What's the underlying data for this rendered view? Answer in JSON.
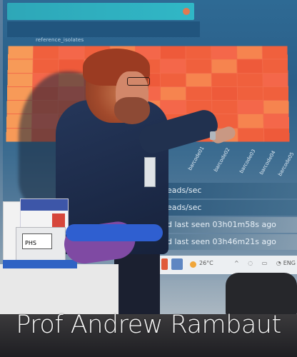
{
  "photo": {
    "screen_small_text": "reference_isolates",
    "heatmap_tick_labels": [
      "barcode01",
      "barcode02",
      "barcode03",
      "barcode04",
      "barcode05"
    ],
    "status_rows": [
      "eads/sec",
      "eads/sec",
      "d last seen 03h01m58s ago",
      "d last seen 03h46m21s ago"
    ],
    "taskbar": {
      "temperature": "26°C",
      "lang": "ENG"
    },
    "box_label": "PHS"
  },
  "caption": {
    "text": "Prof Andrew Rambaut"
  }
}
